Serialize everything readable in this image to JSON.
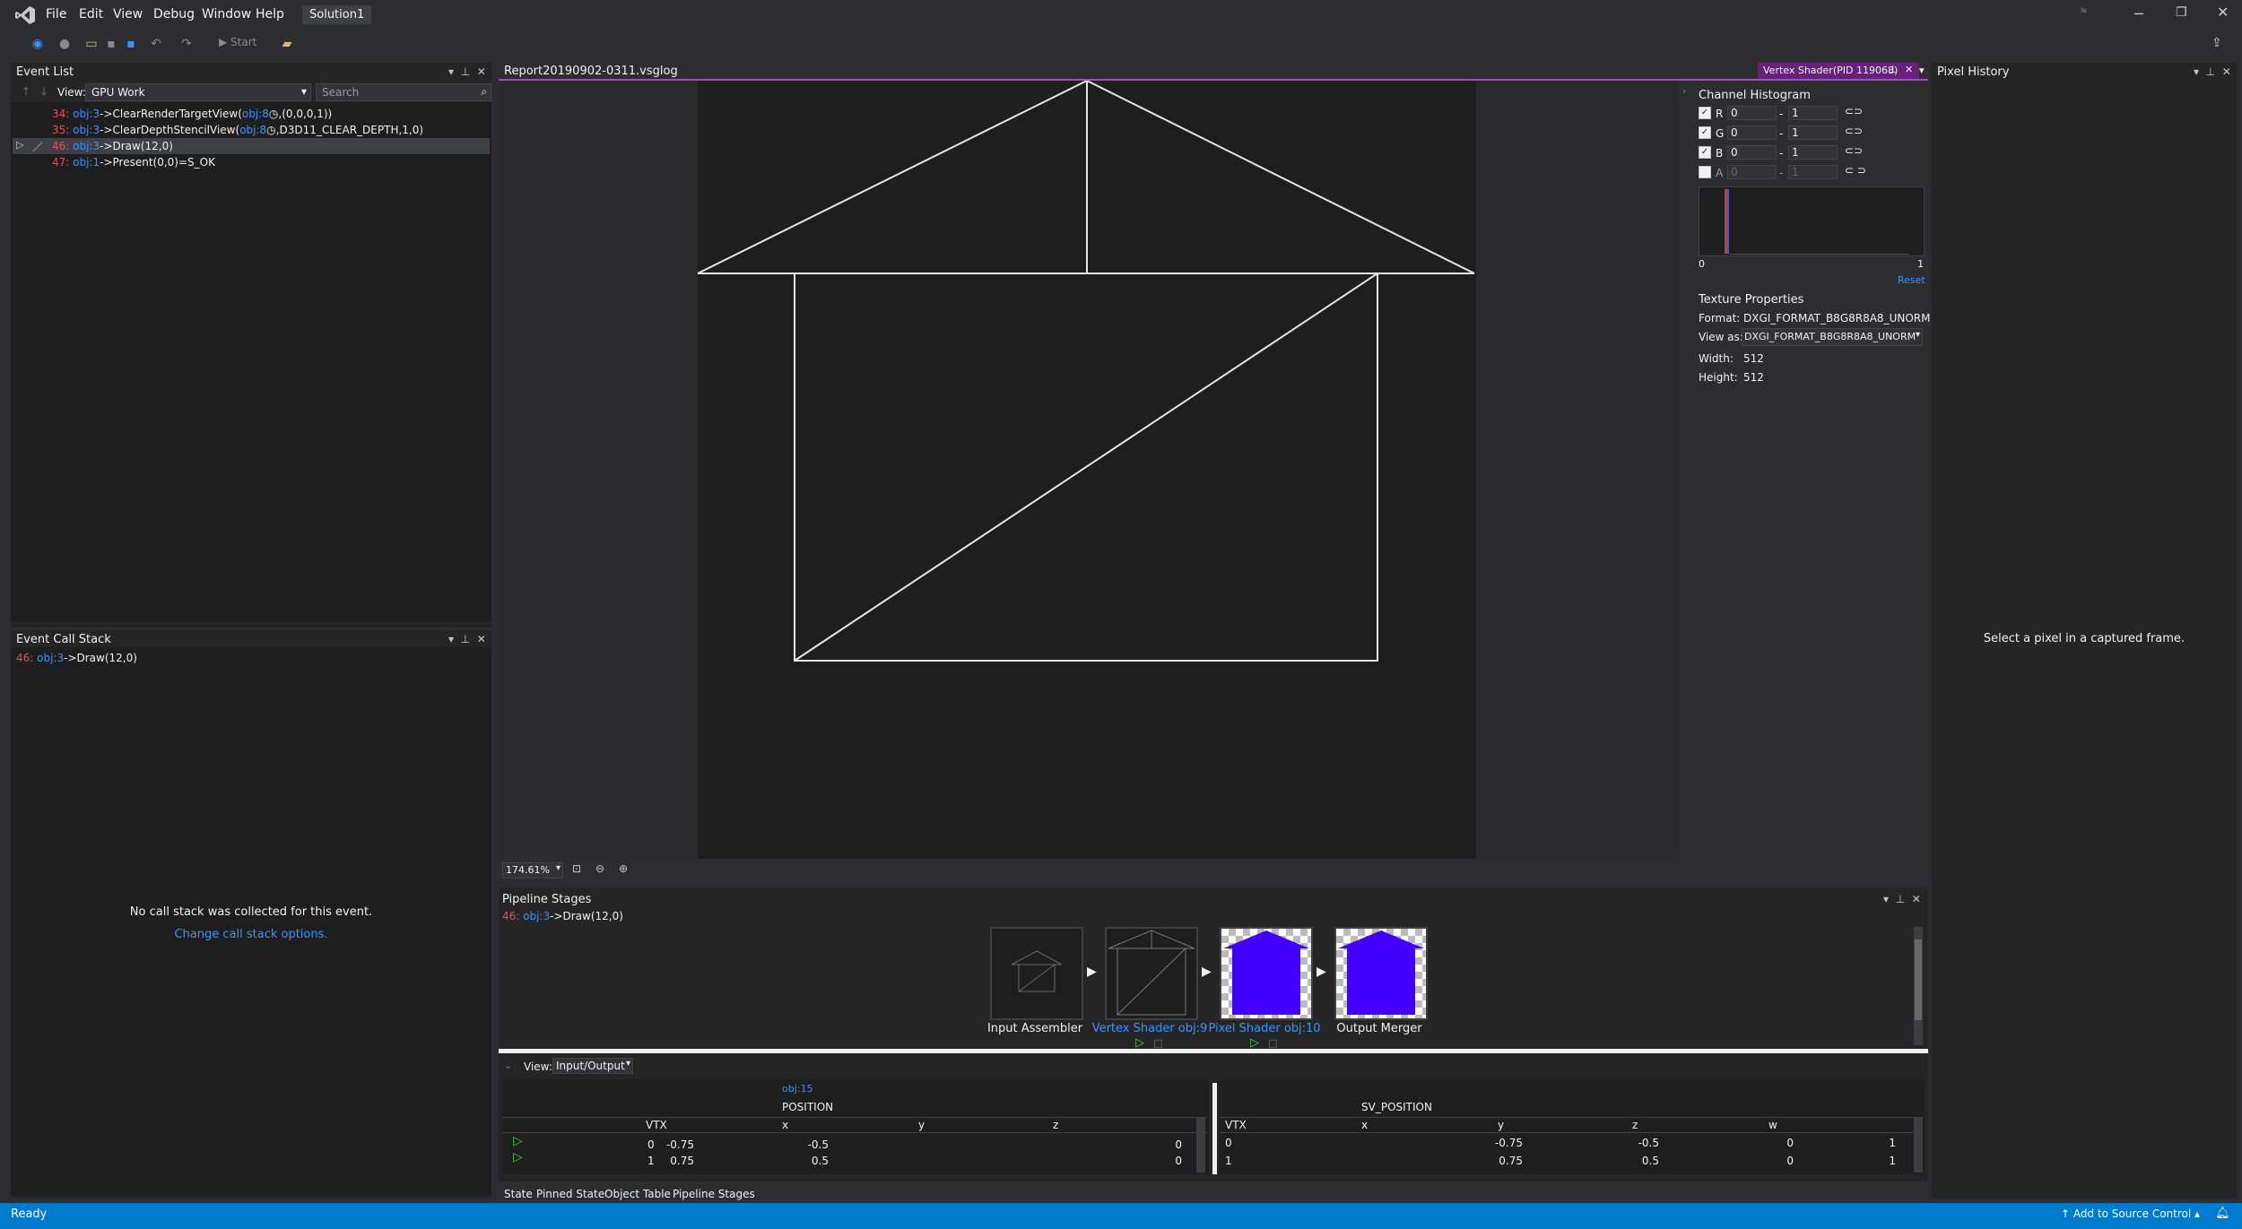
{
  "menu": {
    "items": [
      "File",
      "Edit",
      "View",
      "Debug",
      "Window",
      "Help"
    ],
    "solution": "Solution1"
  },
  "toolbar": {
    "start": "Start"
  },
  "event_list": {
    "title": "Event List",
    "view_label": "View:",
    "view_value": "GPU Work",
    "search_placeholder": "Search",
    "events": [
      {
        "num": "34:",
        "obj": "obj:3",
        "rest": "->ClearRenderTargetView(",
        "obj2": "obj:8",
        "tail": ",(0,0,0,1))"
      },
      {
        "num": "35:",
        "obj": "obj:3",
        "rest": "->ClearDepthStencilView(",
        "obj2": "obj:8",
        "tail": ",D3D11_CLEAR_DEPTH,1,0)"
      },
      {
        "num": "46:",
        "obj": "obj:3",
        "rest": "->Draw(12,0)",
        "obj2": "",
        "tail": ""
      },
      {
        "num": "47:",
        "obj": "obj:1",
        "rest": "->Present(0,0)=S_OK",
        "obj2": "",
        "tail": ""
      }
    ]
  },
  "call_stack": {
    "title": "Event Call Stack",
    "event": {
      "num": "46:",
      "obj": "obj:3",
      "rest": "->Draw(12,0)"
    },
    "empty_msg": "No call stack was collected for this event.",
    "link": "Change call stack options."
  },
  "document": {
    "tab_title": "Report20190902-0311.vsglog",
    "zoom": "174.61%",
    "shader_tab": "Vertex Shader(PID 119068)"
  },
  "histogram": {
    "title": "Channel Histogram",
    "channels": [
      {
        "name": "R",
        "min": "0",
        "max": "1",
        "checked": true
      },
      {
        "name": "G",
        "min": "0",
        "max": "1",
        "checked": true
      },
      {
        "name": "B",
        "min": "0",
        "max": "1",
        "checked": true
      },
      {
        "name": "A",
        "min": "0",
        "max": "1",
        "checked": false
      }
    ],
    "axis_min": "0",
    "axis_max": "1",
    "reset": "Reset"
  },
  "texture": {
    "title": "Texture Properties",
    "format_label": "Format:",
    "format_value": "DXGI_FORMAT_B8G8R8A8_UNORM",
    "viewas_label": "View as:",
    "viewas_value": "DXGI_FORMAT_B8G8R8A8_UNORM",
    "width_label": "Width:",
    "width_value": "512",
    "height_label": "Height:",
    "height_value": "512"
  },
  "pixel_history": {
    "title": "Pixel History",
    "msg": "Select a pixel in a captured frame."
  },
  "pipeline": {
    "title": "Pipeline Stages",
    "event": {
      "num": "46:",
      "obj": "obj:3",
      "rest": "->Draw(12,0)"
    },
    "stages": [
      {
        "label": "Input Assembler"
      },
      {
        "label": "Vertex Shader obj:9"
      },
      {
        "label": "Pixel Shader obj:10"
      },
      {
        "label": "Output Merger"
      }
    ],
    "fill_color": "#4400ff"
  },
  "io": {
    "view_label": "View:",
    "view_value": "Input/Output",
    "input": {
      "obj": "obj:15",
      "semantic": "POSITION",
      "columns": [
        "VTX",
        "x",
        "y",
        "z"
      ],
      "rows": [
        {
          "vtx": "0",
          "x": "-0.75",
          "y": "-0.5",
          "z": "0"
        },
        {
          "vtx": "1",
          "x": "0.75",
          "y": "0.5",
          "z": "0"
        }
      ]
    },
    "output": {
      "semantic": "SV_POSITION",
      "columns": [
        "VTX",
        "x",
        "y",
        "z",
        "w"
      ],
      "rows": [
        {
          "vtx": "0",
          "x": "-0.75",
          "y": "-0.5",
          "z": "0",
          "w": "1"
        },
        {
          "vtx": "1",
          "x": "0.75",
          "y": "0.5",
          "z": "0",
          "w": "1"
        }
      ]
    }
  },
  "bottom_tabs": [
    "State",
    "Pinned State",
    "Object Table",
    "Pipeline Stages"
  ],
  "status": {
    "text": "Ready",
    "source_control": "Add to Source Control"
  }
}
